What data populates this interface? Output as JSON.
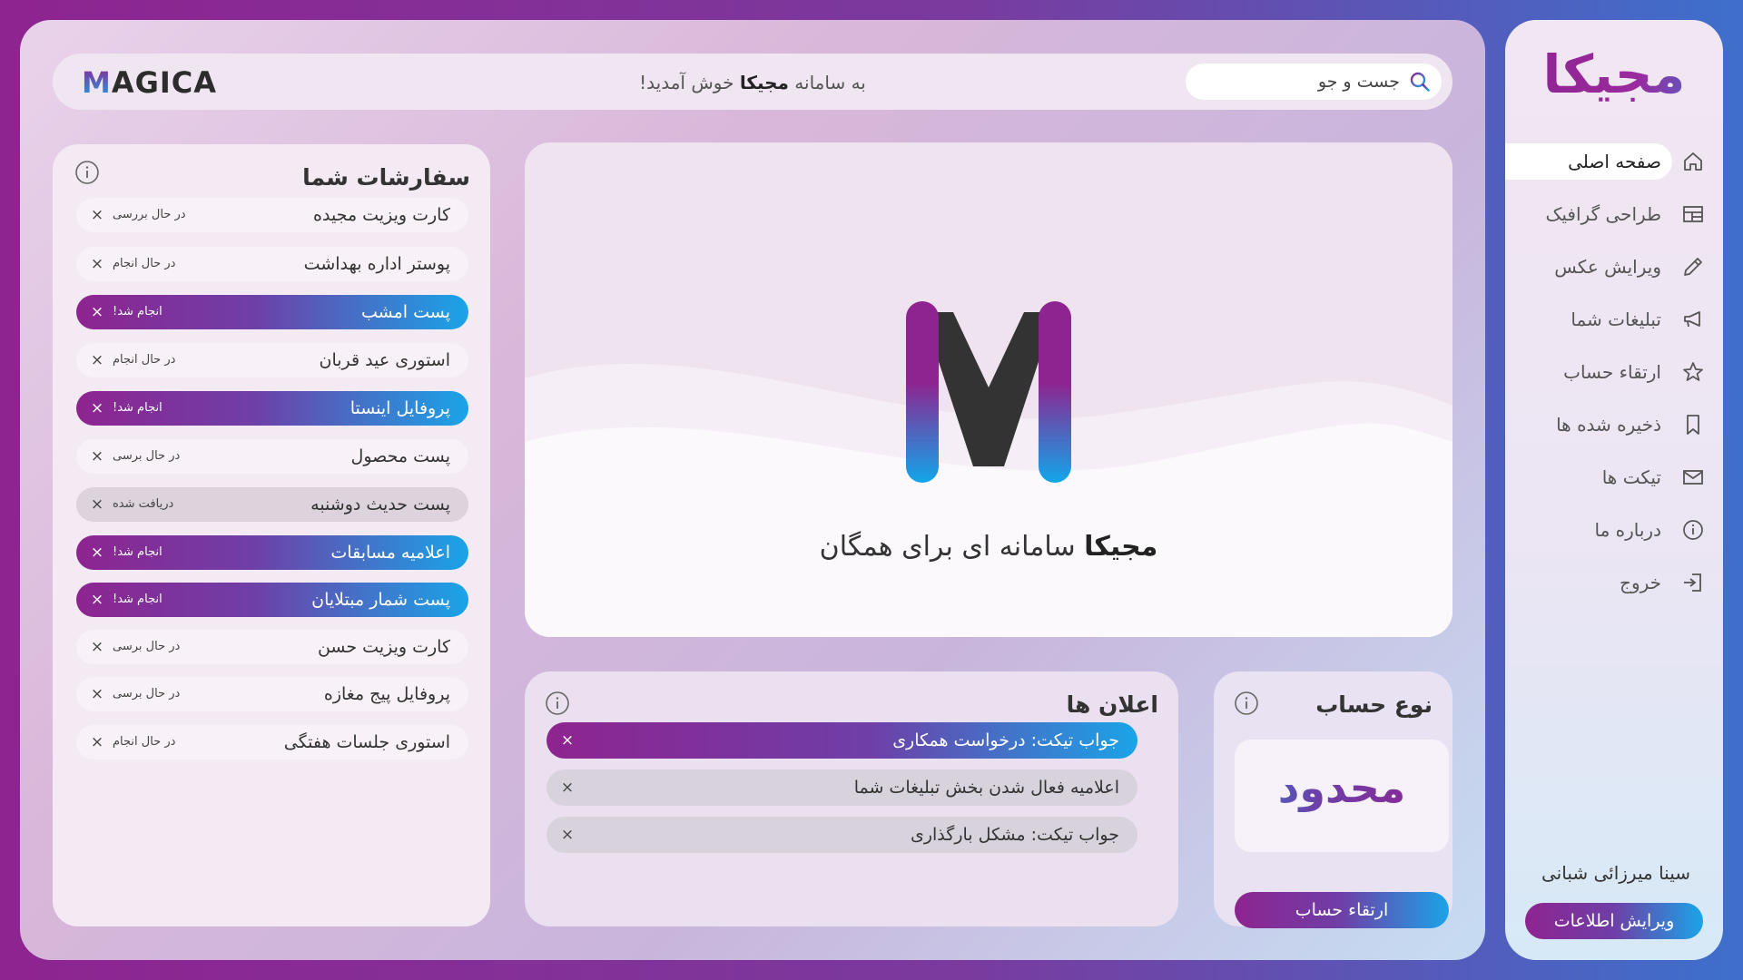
{
  "colors": {
    "primary": "#8e2490",
    "accent": "#1aa4e8",
    "violet": "#6e3fa7"
  },
  "header": {
    "logo": "MAGICA",
    "welcome_prefix": "به سامانه",
    "welcome_brand": "مجیکا",
    "welcome_suffix": "خوش آمدید!",
    "search_placeholder": "جست و جو"
  },
  "orders": {
    "title": "سفارشات شما",
    "items": [
      {
        "title": "کارت ویزیت مجیده",
        "status": "در حال بررسی",
        "kind": "pending"
      },
      {
        "title": "پوستر اداره بهداشت",
        "status": "در حال انجام",
        "kind": "pending"
      },
      {
        "title": "پست امشب",
        "status": "انجام شد!",
        "kind": "done"
      },
      {
        "title": "استوری عید قربان",
        "status": "در حال انجام",
        "kind": "pending"
      },
      {
        "title": "پروفایل اینستا",
        "status": "انجام شد!",
        "kind": "done"
      },
      {
        "title": "پست محصول",
        "status": "در حال برسی",
        "kind": "pending"
      },
      {
        "title": "پست حدیث دوشنبه",
        "status": "دریافت شده",
        "kind": "received"
      },
      {
        "title": "اعلامیه مسابقات",
        "status": "انجام شد!",
        "kind": "done"
      },
      {
        "title": "پست شمار مبتلایان",
        "status": "انجام شد!",
        "kind": "done"
      },
      {
        "title": "کارت ویزیت حسن",
        "status": "در حال برسی",
        "kind": "pending"
      },
      {
        "title": "پروفایل پیج مغازه",
        "status": "در حال برسی",
        "kind": "pending"
      },
      {
        "title": "استوری جلسات هفتگی",
        "status": "در حال انجام",
        "kind": "pending"
      }
    ]
  },
  "hero": {
    "brand": "مجیکا",
    "tagline": "سامانه ای برای همگان"
  },
  "notifications": {
    "title": "اعلان ها",
    "items": [
      {
        "text": "جواب تیکت: درخواست همکاری",
        "active": true
      },
      {
        "text": "اعلامیه فعال شدن بخش تبلیغات شما",
        "active": false
      },
      {
        "text": "جواب تیکت: مشکل بارگذاری",
        "active": false
      }
    ]
  },
  "account": {
    "title": "نوع حساب",
    "type": "محدود",
    "upgrade_label": "ارتقاء حساب"
  },
  "sidebar": {
    "brand": "مجیکا",
    "items": [
      {
        "label": "صفحه اصلی",
        "icon": "home-icon",
        "active": true
      },
      {
        "label": "طراحی گرافیک",
        "icon": "layout-icon",
        "active": false
      },
      {
        "label": "ویرایش عکس",
        "icon": "pencil-icon",
        "active": false
      },
      {
        "label": "تبلیغات شما",
        "icon": "megaphone-icon",
        "active": false
      },
      {
        "label": "ارتقاء حساب",
        "icon": "star-icon",
        "active": false
      },
      {
        "label": "ذخیره شده ها",
        "icon": "bookmark-icon",
        "active": false
      },
      {
        "label": "تیکت ها",
        "icon": "mail-icon",
        "active": false
      },
      {
        "label": "درباره ما",
        "icon": "info-icon",
        "active": false
      },
      {
        "label": "خروج",
        "icon": "logout-icon",
        "active": false
      }
    ],
    "username": "سینا میرزائی شبانی",
    "edit_label": "ویرایش اطلاعات"
  },
  "close_glyph": "×"
}
